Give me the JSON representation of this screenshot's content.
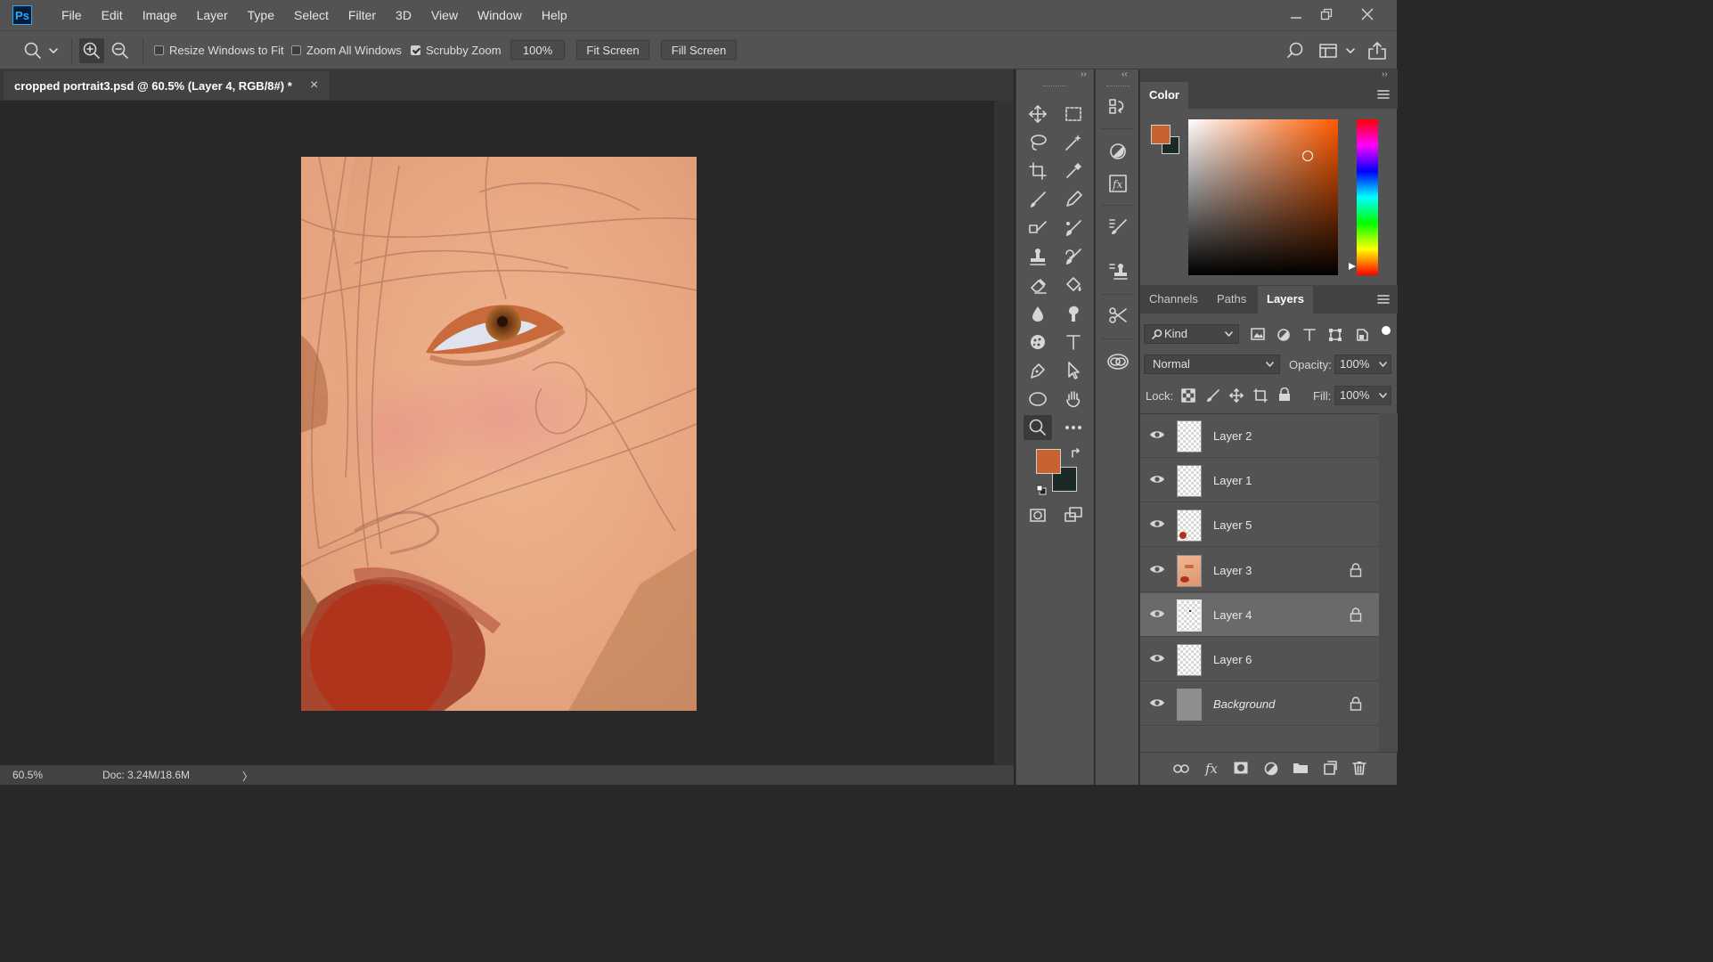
{
  "app": {
    "logo": "Ps",
    "menu": [
      "File",
      "Edit",
      "Image",
      "Layer",
      "Type",
      "Select",
      "Filter",
      "3D",
      "View",
      "Window",
      "Help"
    ]
  },
  "options_bar": {
    "resize_windows": {
      "label": "Resize Windows to Fit",
      "checked": false
    },
    "zoom_all": {
      "label": "Zoom All Windows",
      "checked": false
    },
    "scrubby_zoom": {
      "label": "Scrubby Zoom",
      "checked": true
    },
    "zoom_value": "100%",
    "fit_screen": "Fit Screen",
    "fill_screen": "Fill Screen"
  },
  "document": {
    "tab_title": "cropped portrait3.psd @ 60.5% (Layer 4, RGB/8#) *",
    "close_glyph": "×"
  },
  "status_bar": {
    "zoom": "60.5%",
    "doc_info": "Doc: 3.24M/18.6M",
    "arrow": "〉"
  },
  "colors": {
    "foreground": "#c8622e",
    "background": "#1b2a29",
    "accent": "#31a8ff"
  },
  "color_panel": {
    "title": "Color"
  },
  "layers_panel": {
    "tabs": [
      "Channels",
      "Paths",
      "Layers"
    ],
    "active_tab": "Layers",
    "filter_kind": "Kind",
    "blend_mode": "Normal",
    "opacity_label": "Opacity:",
    "opacity_value": "100%",
    "lock_label": "Lock:",
    "fill_label": "Fill:",
    "fill_value": "100%",
    "layers": [
      {
        "name": "Layer 2",
        "locked": false,
        "selected": false
      },
      {
        "name": "Layer 1",
        "locked": false,
        "selected": false
      },
      {
        "name": "Layer 5",
        "locked": false,
        "selected": false
      },
      {
        "name": "Layer 3",
        "locked": true,
        "selected": false
      },
      {
        "name": "Layer 4",
        "locked": true,
        "selected": true
      },
      {
        "name": "Layer 6",
        "locked": false,
        "selected": false
      },
      {
        "name": "Background",
        "locked": true,
        "selected": false
      }
    ]
  },
  "toolbar": {
    "tools": [
      "move-tool",
      "marquee-tool",
      "lasso-tool",
      "magic-wand-tool",
      "crop-tool",
      "eyedropper-tool",
      "brush-tool",
      "pencil-tool",
      "healing-tool",
      "mixer-brush-tool",
      "stamp-tool",
      "history-brush-tool",
      "eraser-tool",
      "paint-bucket-tool",
      "blur-tool",
      "smudge-tool",
      "sponge-tool",
      "type-tool",
      "pen-tool",
      "path-selection-tool",
      "ellipse-tool",
      "hand-tool",
      "zoom-tool",
      "more-tools"
    ],
    "active": "zoom-tool"
  }
}
